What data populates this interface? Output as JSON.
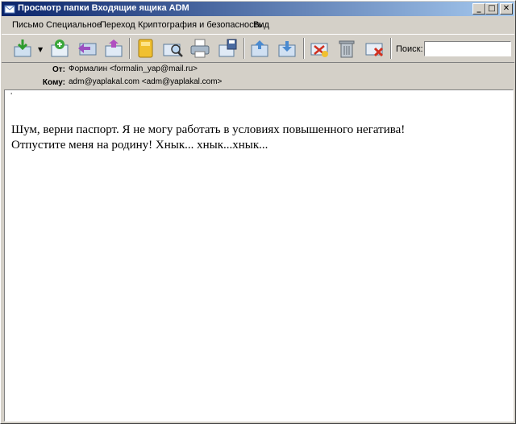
{
  "window": {
    "title": "Просмотр папки Входящие ящика ADM",
    "minimize": "_",
    "maximize": "□",
    "close": "✕"
  },
  "menu": {
    "items": [
      "Письмо",
      "Специальное",
      "Переход",
      "Криптография и безопасность",
      "Вид"
    ]
  },
  "toolbar": {
    "icons": [
      "receive-mail-icon",
      "new-mail-icon",
      "reply-icon",
      "forward-icon",
      "address-book-icon",
      "search-mail-icon",
      "print-icon",
      "save-icon",
      "previous-message-icon",
      "next-message-icon",
      "mark-spam-icon",
      "delete-icon",
      "delete-spam-icon"
    ],
    "dropdown_arrow": "▼",
    "search_label": "Поиск:",
    "search_value": ""
  },
  "headers": {
    "from_label": "От:",
    "from_value": "Формалин <formalin_yap@mail.ru>",
    "to_label": "Кому:",
    "to_value": "adm@yaplakal.com <adm@yaplakal.com>"
  },
  "message": {
    "caret": "'",
    "line1": "Шум, верни паспорт. Я не могу работать в условиях повышенного негатива!",
    "line2": "Отпустите меня на родину! Хнык... хнык...хнык..."
  },
  "colors": {
    "titlebar_start": "#0a246a",
    "titlebar_end": "#a6caf0",
    "chrome": "#d4d0c8"
  }
}
